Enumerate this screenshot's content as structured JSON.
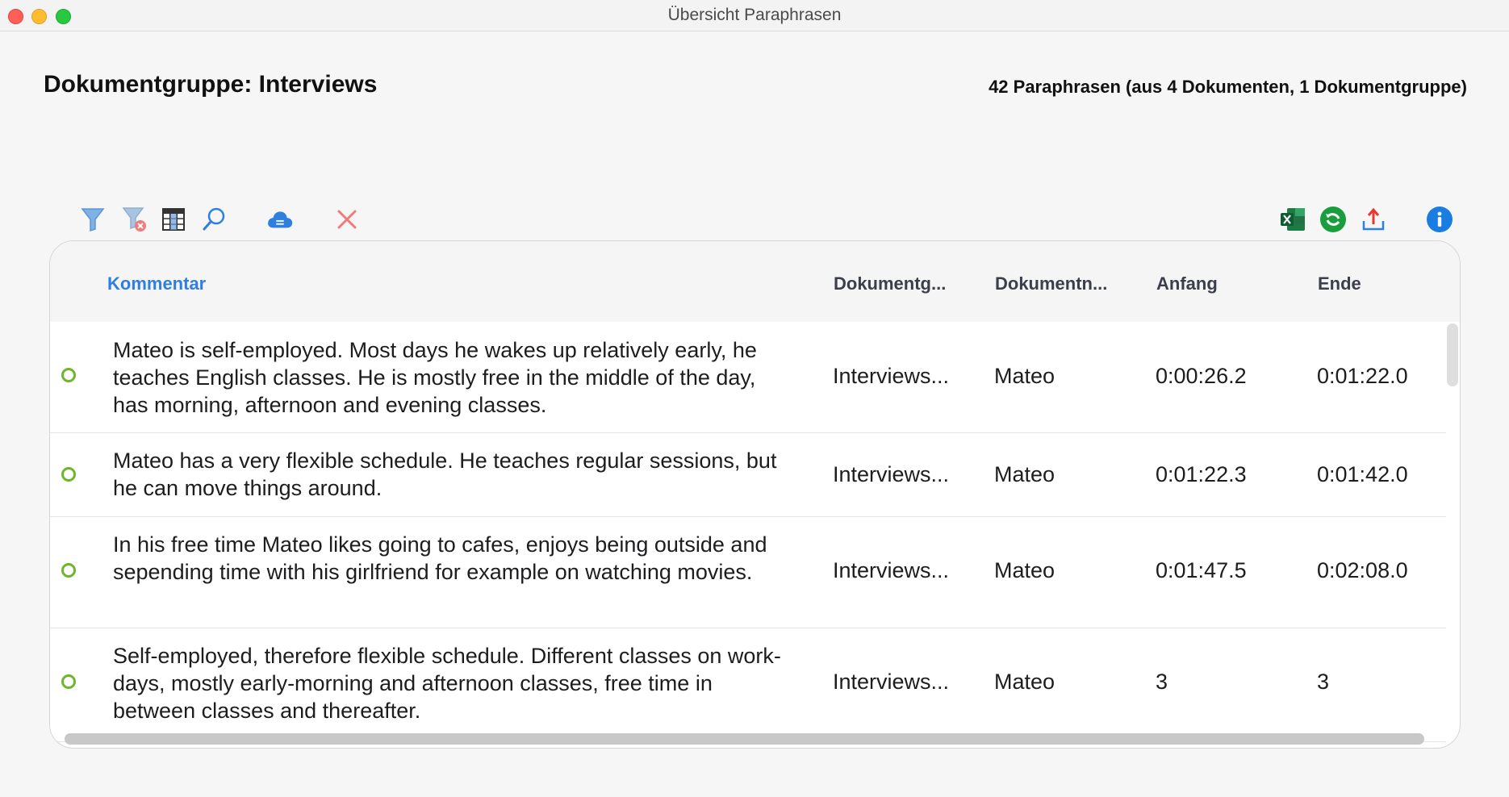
{
  "window": {
    "title": "Übersicht Paraphrasen"
  },
  "header": {
    "title": "Dokumentgruppe: Interviews",
    "summary": "42 Paraphrasen (aus 4 Dokumenten, 1 Dokumentgruppe)"
  },
  "toolbar": {
    "left_icons": [
      "filter-icon",
      "clear-filter-icon",
      "columns-icon",
      "search-icon",
      "cloud-icon",
      "delete-icon"
    ],
    "right_icons": [
      "excel-export-icon",
      "refresh-icon",
      "share-export-icon",
      "info-icon"
    ]
  },
  "colors": {
    "accent": "#2f7fe0",
    "status_ring": "#6fb52c",
    "delete": "#f07b7b",
    "excel": "#1d7a44",
    "info": "#1a7de0"
  },
  "table": {
    "columns": [
      "Kommentar",
      "Dokumentg...",
      "Dokumentn...",
      "Anfang",
      "Ende"
    ],
    "sorted_column": "Kommentar",
    "rows": [
      {
        "comment": "Mateo is self-employed. Most days he wakes up relatively early, he teaches English classes. He is mostly free in the middle of the day, has morning, afternoon and evening classes.",
        "group": "Interviews...",
        "document": "Mateo",
        "start": "0:00:26.2",
        "end": "0:01:22.0"
      },
      {
        "comment": "Mateo has a very flexible schedule. He teaches regular sessions, but he can move things around.",
        "group": "Interviews...",
        "document": "Mateo",
        "start": "0:01:22.3",
        "end": "0:01:42.0"
      },
      {
        "comment": "In his free time Mateo likes going to cafes, enjoys being outside and sepending time with his girlfriend for example on watching movies.",
        "group": "Interviews...",
        "document": "Mateo",
        "start": "0:01:47.5",
        "end": "0:02:08.0"
      },
      {
        "comment": "Self-employed, therefore flexible schedule. Different classes on work-days, mostly early-morning and afternoon classes, free time in between classes and thereafter.",
        "group": "Interviews...",
        "document": "Mateo",
        "start": "3",
        "end": "3"
      }
    ]
  }
}
